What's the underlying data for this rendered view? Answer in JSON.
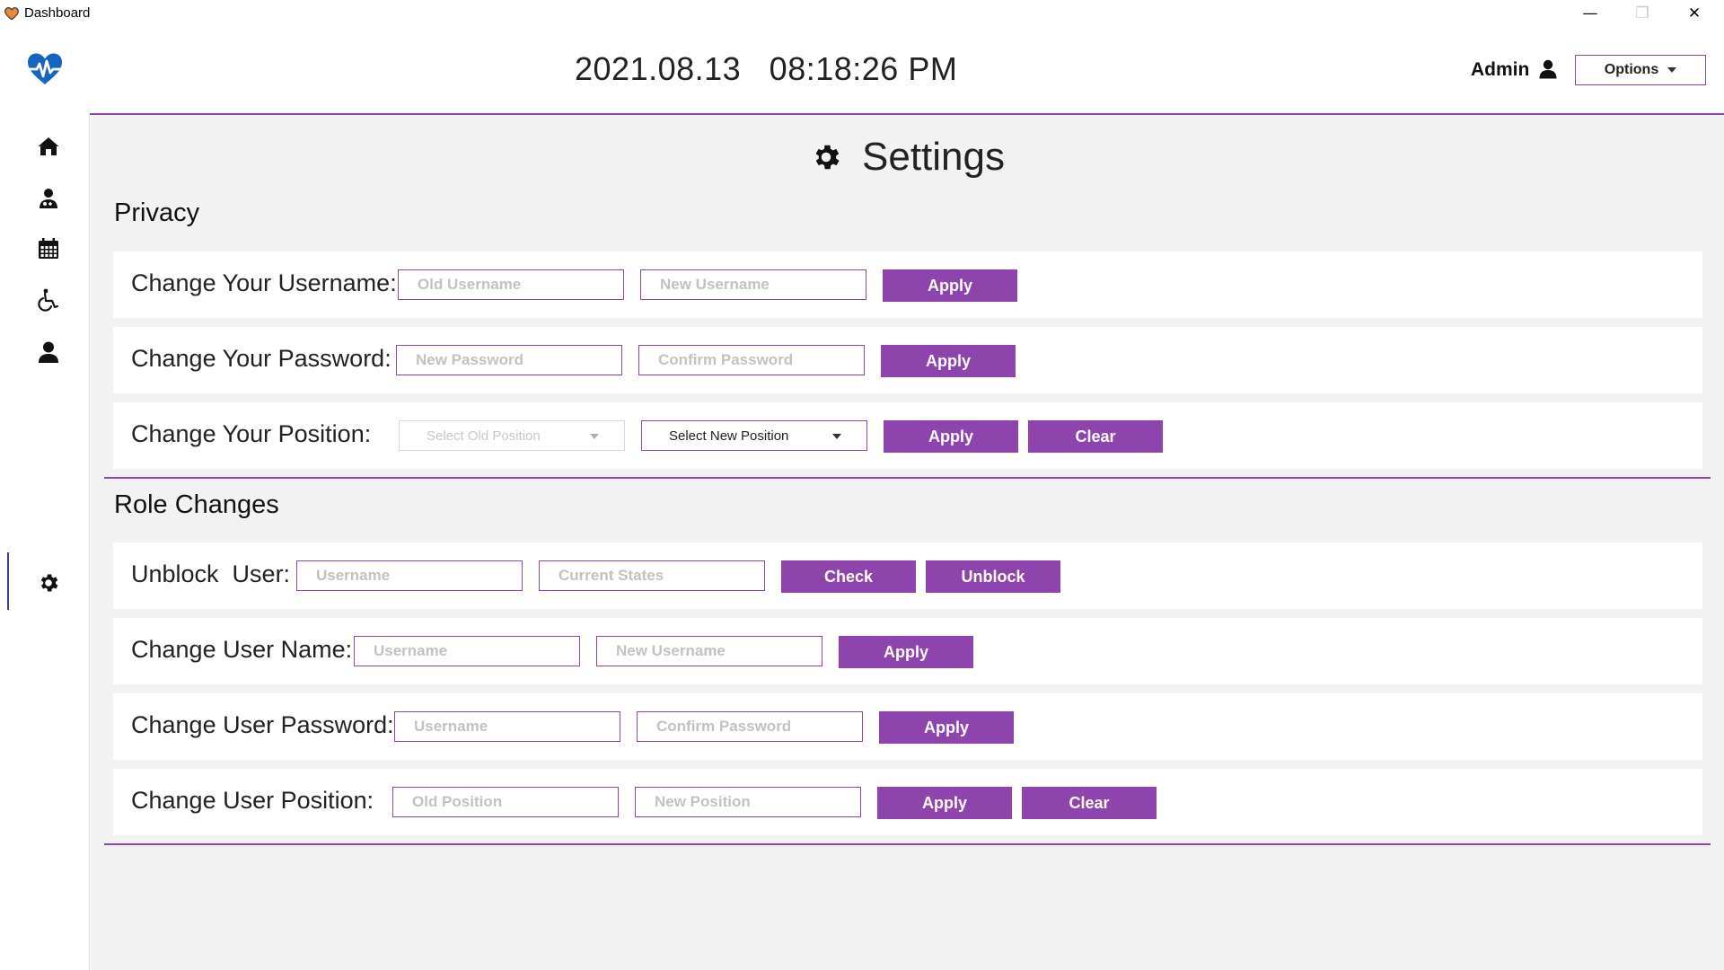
{
  "window": {
    "title": "Dashboard",
    "controls": {
      "minimize": "—",
      "maximize": "❐",
      "close": "✕"
    }
  },
  "header": {
    "date": "2021.08.13",
    "time": "08:18:26 PM",
    "datetime": "2021.08.13   08:18:26 PM",
    "user": "Admin",
    "options_label": "Options",
    "logo_icon": "heartbeat-icon",
    "user_icon": "user-icon"
  },
  "sidebar": {
    "items": [
      {
        "name": "home",
        "icon": "home-icon"
      },
      {
        "name": "doctors",
        "icon": "doctor-icon"
      },
      {
        "name": "appointments",
        "icon": "calendar-icon"
      },
      {
        "name": "patients",
        "icon": "wheelchair-icon"
      },
      {
        "name": "users",
        "icon": "user-icon"
      },
      {
        "name": "settings",
        "icon": "gear-icon",
        "active": true
      }
    ]
  },
  "page": {
    "title": "Settings",
    "title_icon": "gear-icon"
  },
  "privacy": {
    "title": "Privacy",
    "username": {
      "label": "Change Your Username:",
      "old_placeholder": "Old Username",
      "new_placeholder": "New Username",
      "apply": "Apply"
    },
    "password": {
      "label": "Change Your Password:",
      "new_placeholder": "New Password",
      "confirm_placeholder": "Confirm Password",
      "apply": "Apply"
    },
    "position": {
      "label": "Change Your Position:",
      "old_select": "Select Old Position",
      "new_select": "Select New Position",
      "apply": "Apply",
      "clear": "Clear"
    }
  },
  "roles": {
    "title": "Role Changes",
    "unblock": {
      "label": "Unblock  User:",
      "username_placeholder": "Username",
      "state_placeholder": "Current States",
      "check": "Check",
      "unblock": "Unblock"
    },
    "user_name": {
      "label": "Change User Name:",
      "username_placeholder": "Username",
      "new_placeholder": "New Username",
      "apply": "Apply"
    },
    "user_password": {
      "label": "Change User Password:",
      "username_placeholder": "Username",
      "confirm_placeholder": "Confirm Password",
      "apply": "Apply"
    },
    "user_position": {
      "label": "Change User Position:",
      "old_placeholder": "Old Position",
      "new_placeholder": "New Position",
      "apply": "Apply",
      "clear": "Clear"
    }
  },
  "colors": {
    "accent": "#8e44ad",
    "background": "#f2f2f2",
    "logo": "#1565c0"
  }
}
